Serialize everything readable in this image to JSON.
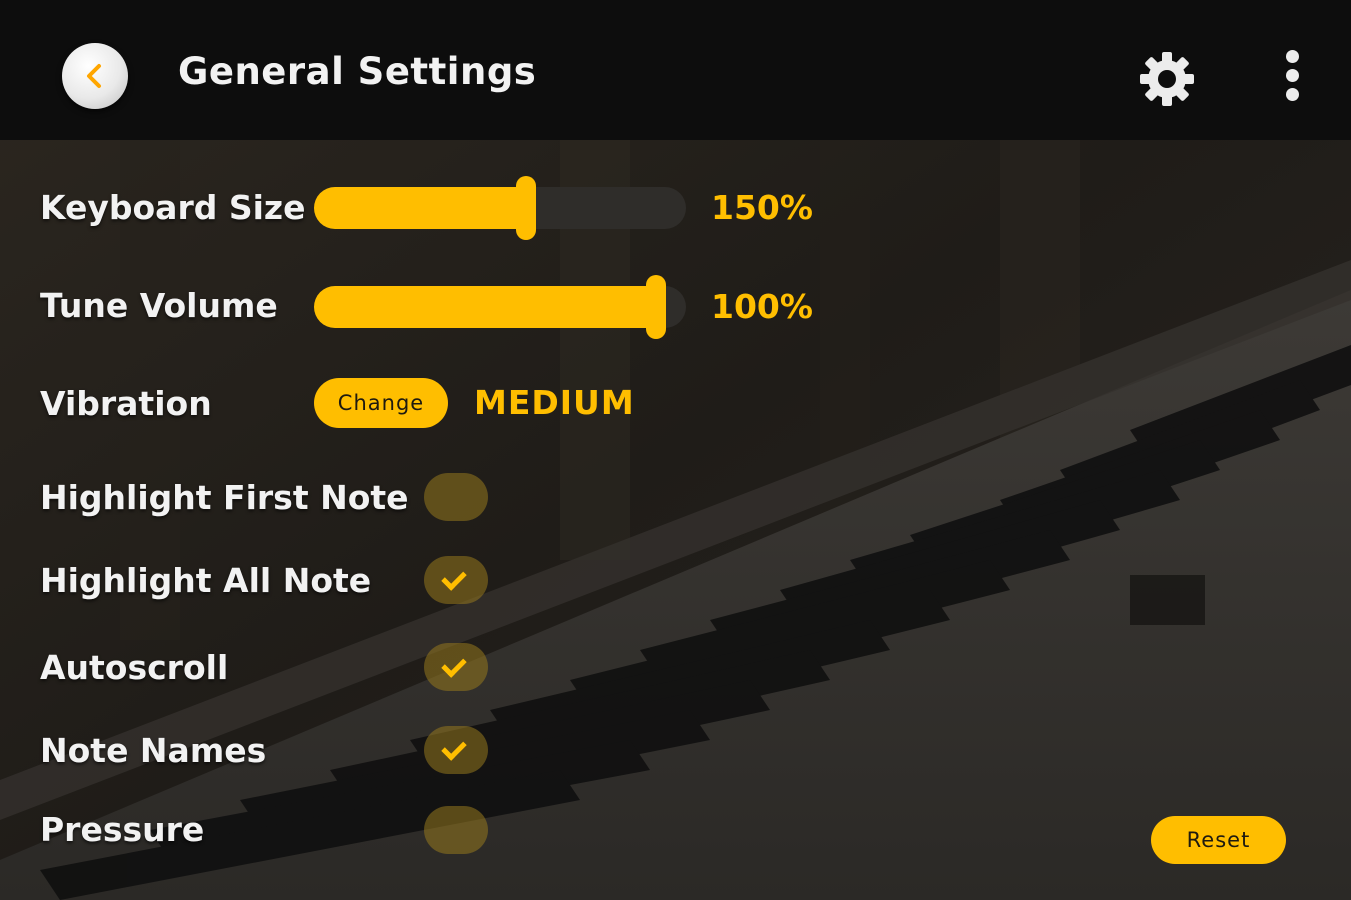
{
  "header": {
    "title": "General Settings",
    "back_icon": "chevron-left-icon",
    "settings_icon": "gear-icon",
    "menu_icon": "more-vertical-icon"
  },
  "settings": {
    "keyboard_size": {
      "label": "Keyboard Size",
      "value_text": "150%",
      "fill_fraction": 0.57
    },
    "tune_volume": {
      "label": "Tune Volume",
      "value_text": "100%",
      "fill_fraction": 0.92
    },
    "vibration": {
      "label": "Vibration",
      "button_label": "Change",
      "value": "MEDIUM"
    },
    "toggles": [
      {
        "label": "Highlight First Note",
        "checked": false
      },
      {
        "label": "Highlight All Note",
        "checked": true
      },
      {
        "label": "Autoscroll",
        "checked": true
      },
      {
        "label": "Note Names",
        "checked": true
      },
      {
        "label": "Pressure",
        "checked": false
      }
    ]
  },
  "footer": {
    "reset_label": "Reset"
  },
  "colors": {
    "accent": "#ffbe00",
    "header_bg": "#0d0d0d"
  }
}
